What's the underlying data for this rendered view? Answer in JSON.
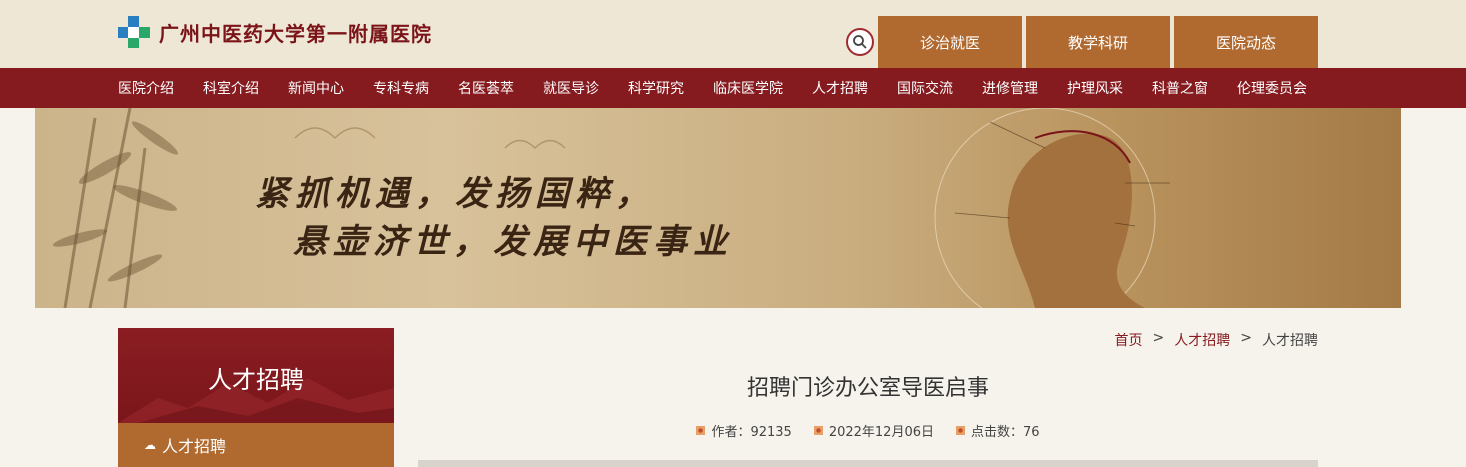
{
  "header": {
    "hospital_name": "广州中医药大学第一附属医院",
    "quick_tabs": [
      "诊治就医",
      "教学科研",
      "医院动态"
    ]
  },
  "nav": {
    "items": [
      "医院介绍",
      "科室介绍",
      "新闻中心",
      "专科专病",
      "名医荟萃",
      "就医导诊",
      "科学研究",
      "临床医学院",
      "人才招聘",
      "国际交流",
      "进修管理",
      "护理风采",
      "科普之窗",
      "伦理委员会"
    ]
  },
  "banner": {
    "slogan_line1": "紧抓机遇，发扬国粹，",
    "slogan_line2": "悬壶济世，发展中医事业"
  },
  "sidebar": {
    "title": "人才招聘",
    "items": [
      "人才招聘"
    ]
  },
  "breadcrumb": {
    "home": "首页",
    "sep": ">",
    "level1": "人才招聘",
    "level2": "人才招聘"
  },
  "article": {
    "title": "招聘门诊办公室导医启事",
    "author": "作者：92135",
    "date": "2022年12月06日",
    "views": "点击数：76"
  },
  "colors": {
    "brand_red": "#851a1f",
    "accent_orange": "#b06a30",
    "header_bg": "#efe7d6"
  }
}
